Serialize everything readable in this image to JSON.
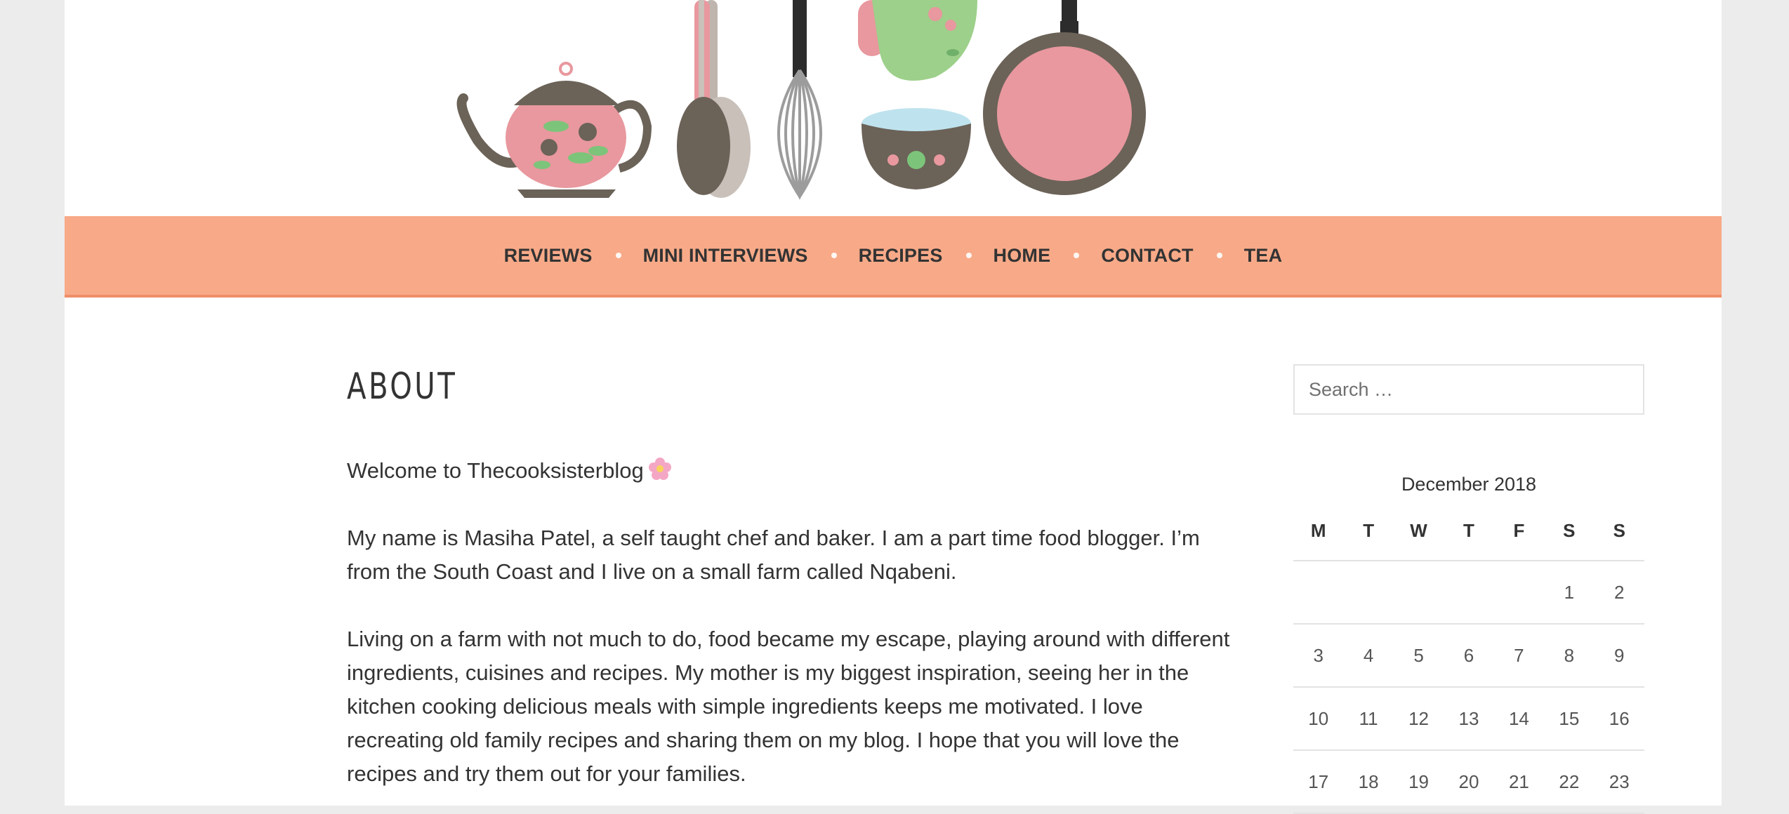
{
  "header": {
    "illustration": [
      "teapot-icon",
      "spoon-icon",
      "whisk-icon",
      "oven-mitt-icon",
      "bowl-icon",
      "frying-pan-icon"
    ]
  },
  "nav": {
    "items": [
      {
        "label": "REVIEWS"
      },
      {
        "label": "MINI INTERVIEWS"
      },
      {
        "label": "RECIPES"
      },
      {
        "label": "HOME"
      },
      {
        "label": "CONTACT"
      },
      {
        "label": "TEA"
      }
    ],
    "colors": {
      "background": "#f8aa88",
      "border": "#ef8e69"
    }
  },
  "main": {
    "title": "ABOUT",
    "welcome": "Welcome to Thecooksisterblog",
    "welcome_icon": "cherry-blossom-icon",
    "paragraphs": [
      "My name is Masiha Patel, a self taught chef and baker. I am a part time food blogger. I’m from the South Coast and I live on a small farm called Nqabeni.",
      "Living on a farm with not much to do, food became my escape, playing around with different ingredients, cuisines and recipes. My mother is my biggest inspiration, seeing her in the kitchen cooking delicious meals with simple ingredients keeps me motivated. I love recreating old family recipes and sharing them on my blog. I hope that you will love the recipes and try them out for your families."
    ]
  },
  "sidebar": {
    "search": {
      "placeholder": "Search …"
    },
    "calendar": {
      "caption": "December 2018",
      "weekdays": [
        "M",
        "T",
        "W",
        "T",
        "F",
        "S",
        "S"
      ],
      "weeks": [
        [
          "",
          "",
          "",
          "",
          "",
          "1",
          "2"
        ],
        [
          "3",
          "4",
          "5",
          "6",
          "7",
          "8",
          "9"
        ],
        [
          "10",
          "11",
          "12",
          "13",
          "14",
          "15",
          "16"
        ],
        [
          "17",
          "18",
          "19",
          "20",
          "21",
          "22",
          "23"
        ]
      ]
    }
  }
}
